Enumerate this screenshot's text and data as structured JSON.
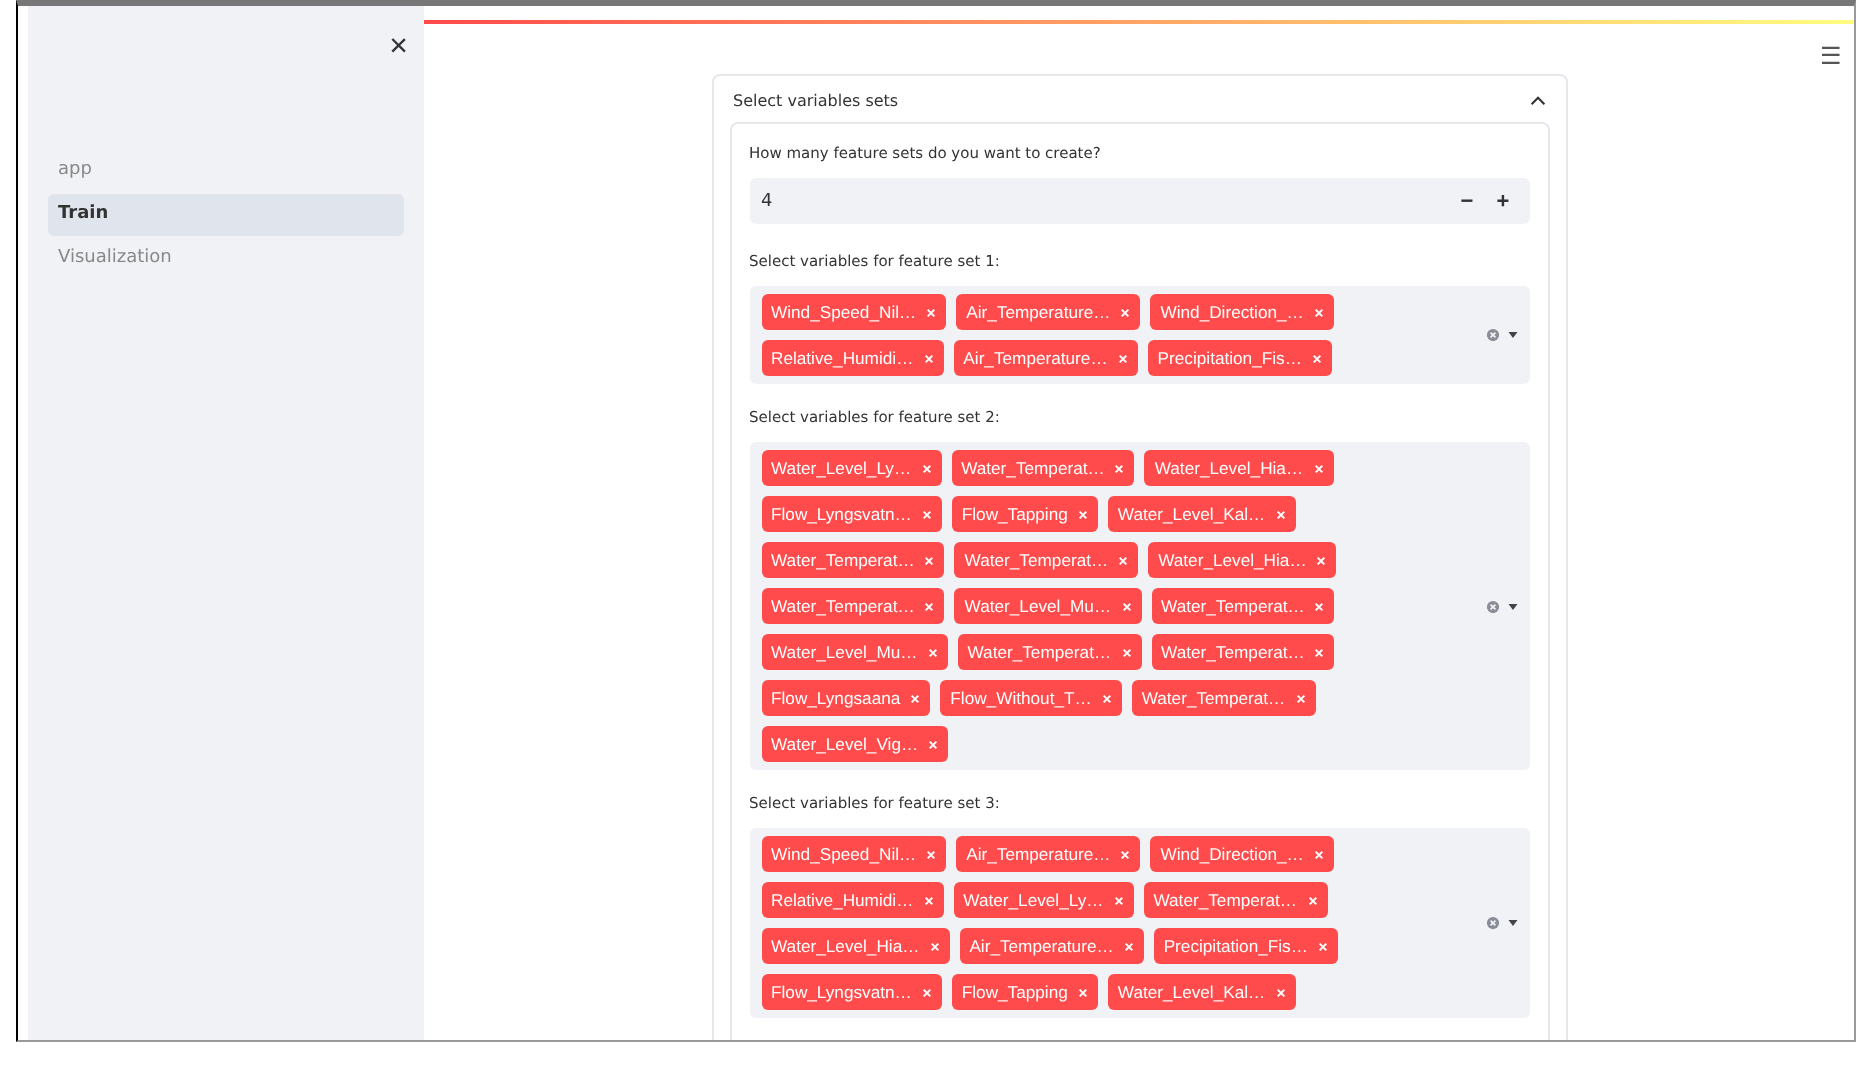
{
  "sidebar": {
    "close": "×",
    "items": [
      {
        "label": "app",
        "selected": false
      },
      {
        "label": "Train",
        "selected": true
      },
      {
        "label": "Visualization",
        "selected": false
      }
    ]
  },
  "menu": "☰",
  "expander": {
    "title": "Select variables sets",
    "expanded": true,
    "number_input": {
      "label": "How many feature sets do you want to create?",
      "value": "4",
      "minus": "−",
      "plus": "+"
    },
    "feature_sets": [
      {
        "label": "Select variables for feature set 1:",
        "tags": [
          "Wind_Speed_Nil…",
          "Air_Temperature…",
          "Wind_Direction_…",
          "Relative_Humidi…",
          "Air_Temperature…",
          "Precipitation_Fis…"
        ]
      },
      {
        "label": "Select variables for feature set 2:",
        "tags": [
          "Water_Level_Ly…",
          "Water_Temperat…",
          "Water_Level_Hia…",
          "Flow_Lyngsvatn…",
          "Flow_Tapping",
          "Water_Level_Kal…",
          "Water_Temperat…",
          "Water_Temperat…",
          "Water_Level_Hia…",
          "Water_Temperat…",
          "Water_Level_Mu…",
          "Water_Temperat…",
          "Water_Level_Mu…",
          "Water_Temperat…",
          "Water_Temperat…",
          "Flow_Lyngsaana",
          "Flow_Without_T…",
          "Water_Temperat…",
          "Water_Level_Vig…"
        ]
      },
      {
        "label": "Select variables for feature set 3:",
        "tags": [
          "Wind_Speed_Nil…",
          "Air_Temperature…",
          "Wind_Direction_…",
          "Relative_Humidi…",
          "Water_Level_Ly…",
          "Water_Temperat…",
          "Water_Level_Hia…",
          "Air_Temperature…",
          "Precipitation_Fis…",
          "Flow_Lyngsvatn…",
          "Flow_Tapping",
          "Water_Level_Kal…"
        ]
      }
    ]
  }
}
